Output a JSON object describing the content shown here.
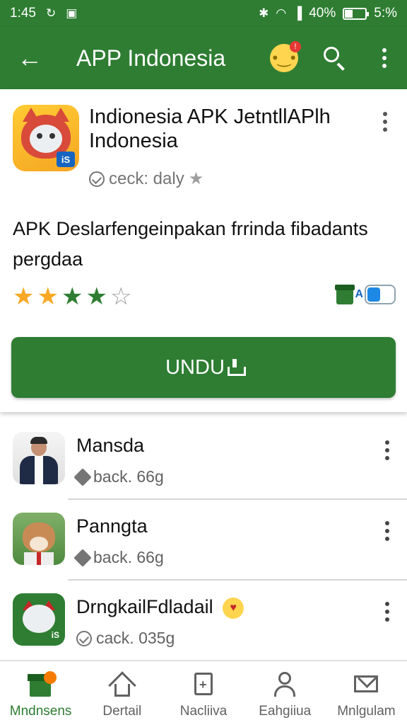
{
  "status_bar": {
    "time": "1:45",
    "battery_text": "40%",
    "battery_level": 0.4,
    "extra_text": "5:%"
  },
  "app_bar": {
    "title": "APP Indonesia",
    "notification_badge": "!"
  },
  "app_detail": {
    "title": "Indionesia APK JetntllAPlh Indonesia",
    "subtitle": "ceck: daly",
    "icon_badge": "iS",
    "description": "APK Deslarfengeinpakan frrinda fibadants pergdaa",
    "rating": 4,
    "rating_max": 5,
    "toggle_label": "A",
    "download_label": "UNDU",
    "colors": {
      "primary": "#2e7d32",
      "star_gold": "#f9a825",
      "star_green": "#2e7d32"
    }
  },
  "list": {
    "items": [
      {
        "name": "Mansda",
        "meta": "back. 66g"
      },
      {
        "name": "Panngta",
        "meta": "back. 66g"
      },
      {
        "name": "DrngkailFdladail",
        "meta": "cack. 035g"
      }
    ]
  },
  "bottom_nav": {
    "items": [
      {
        "label": "Mndnsens",
        "icon": "gift-icon",
        "active": true
      },
      {
        "label": "Dertail",
        "icon": "home-icon",
        "active": false
      },
      {
        "label": "Nacliiva",
        "icon": "clipboard-plus-icon",
        "active": false
      },
      {
        "label": "Eahgiiua",
        "icon": "person-icon",
        "active": false
      },
      {
        "label": "Mnlgulam",
        "icon": "mail-icon",
        "active": false
      }
    ]
  }
}
